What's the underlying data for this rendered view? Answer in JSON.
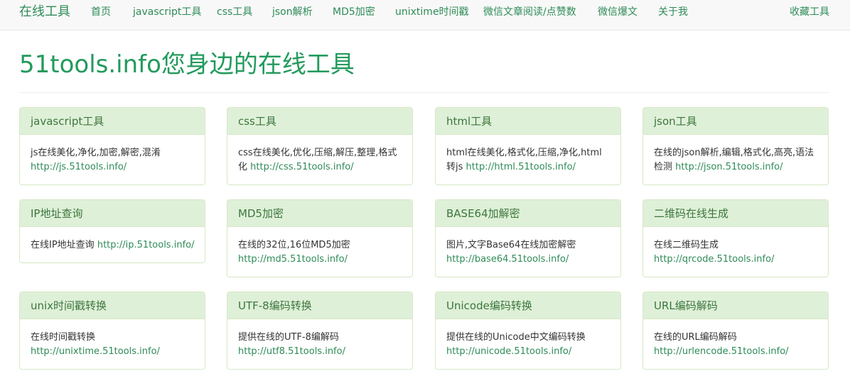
{
  "nav": {
    "brand": "在线工具",
    "items": [
      "首页",
      "javascript工具",
      "css工具",
      "json解析",
      "MD5加密",
      "unixtime时间戳",
      "微信文章阅读/点赞数",
      "微信爆文",
      "关于我"
    ],
    "right": "收藏工具"
  },
  "page": {
    "title": "51tools.info您身边的在线工具"
  },
  "cards": [
    {
      "title": "javascript工具",
      "desc": "js在线美化,净化,加密,解密,混淆",
      "link": "http://js.51tools.info/"
    },
    {
      "title": "css工具",
      "desc": "css在线美化,优化,压缩,解压,整理,格式化",
      "link": "http://css.51tools.info/"
    },
    {
      "title": "html工具",
      "desc": "html在线美化,格式化,压缩,净化,html转js",
      "link": "http://html.51tools.info/"
    },
    {
      "title": "json工具",
      "desc": "在线的json解析,编辑,格式化,高亮,语法检测",
      "link": "http://json.51tools.info/"
    },
    {
      "title": "IP地址查询",
      "desc": "在线IP地址查询",
      "link": "http://ip.51tools.info/"
    },
    {
      "title": "MD5加密",
      "desc": "在线的32位,16位MD5加密",
      "link": "http://md5.51tools.info/"
    },
    {
      "title": "BASE64加解密",
      "desc": "图片,文字Base64在线加密解密",
      "link": "http://base64.51tools.info/"
    },
    {
      "title": "二维码在线生成",
      "desc": "在线二维码生成",
      "link": "http://qrcode.51tools.info/"
    },
    {
      "title": "unix时间戳转换",
      "desc": "在线时间戳转换",
      "link": "http://unixtime.51tools.info/"
    },
    {
      "title": "UTF-8编码转换",
      "desc": "提供在线的UTF-8编解码",
      "link": "http://utf8.51tools.info/"
    },
    {
      "title": "Unicode编码转换",
      "desc": "提供在线的Unicode中文编码转换",
      "link": "http://unicode.51tools.info/"
    },
    {
      "title": "URL编码解码",
      "desc": "在线的URL编码解码",
      "link": "http://urlencode.51tools.info/"
    }
  ]
}
